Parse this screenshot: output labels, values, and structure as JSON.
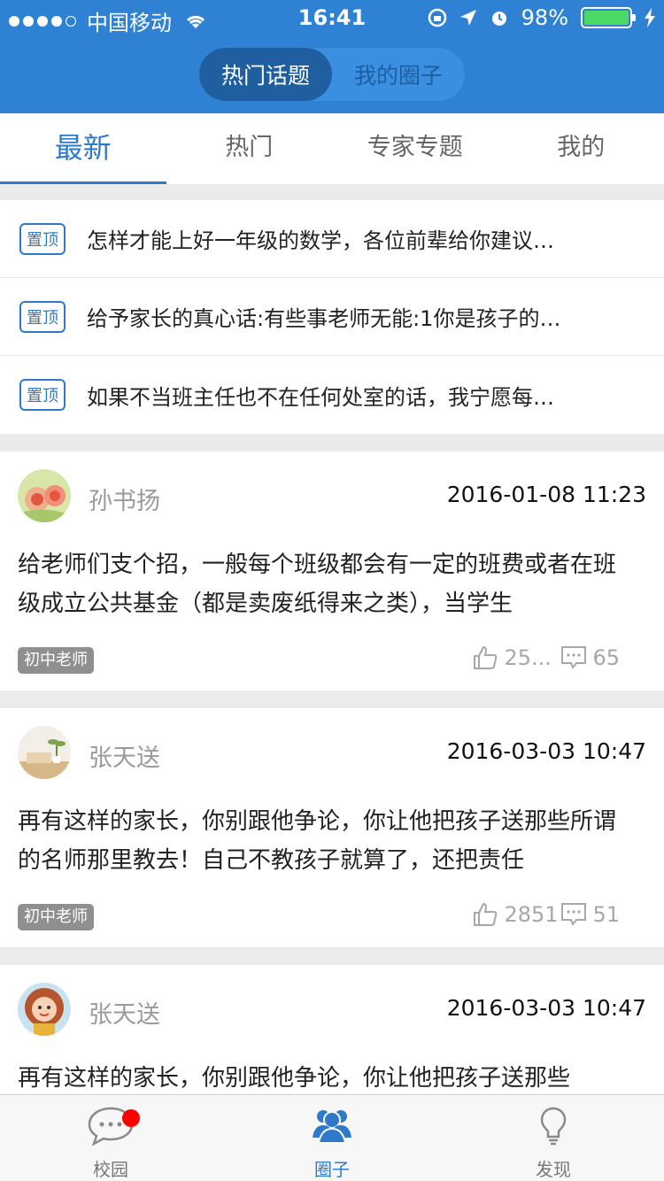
{
  "status_bar": {
    "carrier": "中国移动",
    "time": "16:41",
    "battery": "98%"
  },
  "segment": {
    "items": [
      "热门话题",
      "我的圈子"
    ],
    "active": 0
  },
  "tabs": [
    "最新",
    "热门",
    "专家专题",
    "我的"
  ],
  "pinned": {
    "badge": "置顶",
    "items": [
      "怎样才能上好一年级的数学，各位前辈给你建议…",
      "给予家长的真心话:有些事老师无能:1你是孩子的…",
      "如果不当班主任也不在任何处室的话，我宁愿每…"
    ]
  },
  "posts": [
    {
      "author": "孙书扬",
      "date": "2016-01-08 11:23",
      "content": "给老师们支个招，一般每个班级都会有一定的班费或者在班级成立公共基金（都是卖废纸得来之类），当学生",
      "tag": "初中老师",
      "likes": "25...",
      "comments": "65"
    },
    {
      "author": "张天送",
      "date": "2016-03-03 10:47",
      "content": "再有这样的家长，你别跟他争论，你让他把孩子送那些所谓的名师那里教去！自己不教孩子就算了，还把责任",
      "tag": "初中老师",
      "likes": "2851",
      "comments": "51"
    },
    {
      "author": "张天送",
      "date": "2016-03-03 10:47",
      "content": "再有这样的家长，你别跟他争论，你让他把孩子送那些"
    }
  ],
  "bottom_nav": [
    "校园",
    "圈子",
    "发现"
  ],
  "colors": {
    "brand_blue": "#2f82d3",
    "active_tab": "#2f7ac8",
    "badge_red": "#ff0000"
  }
}
